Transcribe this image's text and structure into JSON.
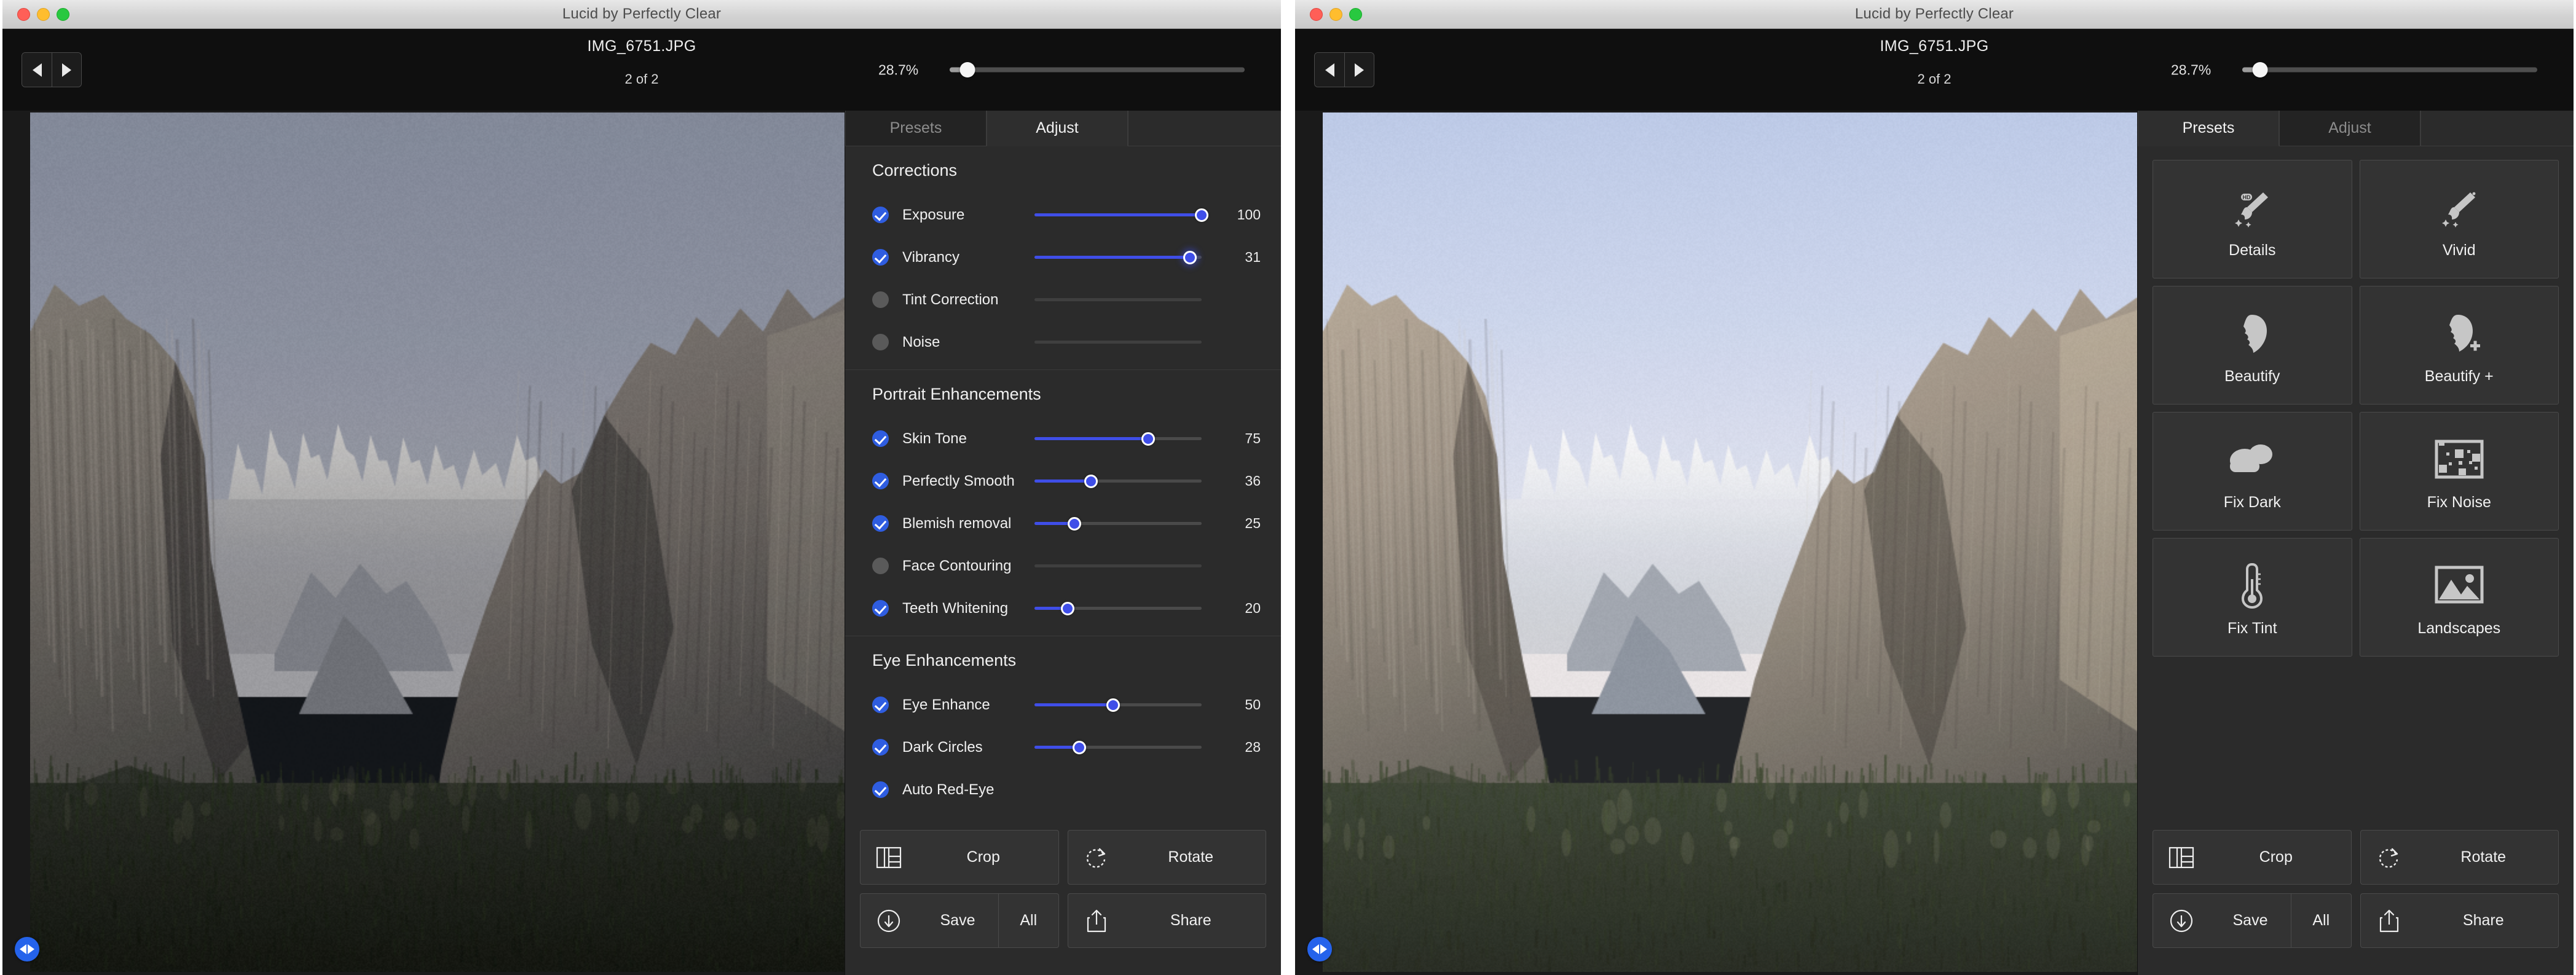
{
  "window_title": "Lucid by Perfectly Clear",
  "toolbar": {
    "prev_icon": "triangle-left-icon",
    "next_icon": "triangle-right-icon",
    "file_name": "IMG_6751.JPG",
    "file_count": "2 of 2",
    "zoom_value": "28.7%",
    "zoom_percent": 6
  },
  "tabs": {
    "presets": "Presets",
    "adjust": "Adjust"
  },
  "left_window": {
    "active_tab": "Adjust",
    "sections": [
      {
        "title": "Corrections",
        "rows": [
          {
            "label": "Exposure",
            "enabled": true,
            "value": "100",
            "percent": 100
          },
          {
            "label": "Vibrancy",
            "enabled": true,
            "value": "31",
            "percent": 93,
            "glow": true
          },
          {
            "label": "Tint Correction",
            "enabled": false,
            "value": "",
            "percent": 0
          },
          {
            "label": "Noise",
            "enabled": false,
            "value": "",
            "percent": 0
          }
        ]
      },
      {
        "title": "Portrait Enhancements",
        "rows": [
          {
            "label": "Skin Tone",
            "enabled": true,
            "value": "75",
            "percent": 68
          },
          {
            "label": "Perfectly Smooth",
            "enabled": true,
            "value": "36",
            "percent": 34
          },
          {
            "label": "Blemish removal",
            "enabled": true,
            "value": "25",
            "percent": 24
          },
          {
            "label": "Face Contouring",
            "enabled": false,
            "value": "",
            "percent": 0
          },
          {
            "label": "Teeth Whitening",
            "enabled": true,
            "value": "20",
            "percent": 20
          }
        ]
      },
      {
        "title": "Eye Enhancements",
        "rows": [
          {
            "label": "Eye Enhance",
            "enabled": true,
            "value": "50",
            "percent": 47
          },
          {
            "label": "Dark Circles",
            "enabled": true,
            "value": "28",
            "percent": 27
          },
          {
            "label": "Auto Red-Eye",
            "enabled": true,
            "value": "",
            "percent": -1
          }
        ]
      }
    ]
  },
  "right_window": {
    "active_tab": "Presets",
    "presets": [
      {
        "label": "Details",
        "icon": "brush-hd-icon"
      },
      {
        "label": "Vivid",
        "icon": "brush-icon"
      },
      {
        "label": "Beautify",
        "icon": "face-silhouette-icon"
      },
      {
        "label": "Beautify +",
        "icon": "face-silhouette-plus-icon"
      },
      {
        "label": "Fix Dark",
        "icon": "clouds-icon"
      },
      {
        "label": "Fix Noise",
        "icon": "noisy-image-icon"
      },
      {
        "label": "Fix Tint",
        "icon": "thermometer-icon"
      },
      {
        "label": "Landscapes",
        "icon": "landscape-photo-icon"
      }
    ]
  },
  "actions": {
    "crop": "Crop",
    "rotate": "Rotate",
    "save": "Save",
    "all": "All",
    "share": "Share",
    "crop_icon": "crop-grid-icon",
    "rotate_icon": "rotate-arrow-icon",
    "save_icon": "download-circle-icon",
    "share_icon": "share-box-icon"
  },
  "compare_button": {
    "icon": "compare-left-right-icon"
  },
  "colors": {
    "accent_blue": "#2f5de0",
    "slider_blue": "#3f4ee8",
    "panel_bg": "#2b2b2b",
    "tile_bg": "#333333",
    "toolbar_bg": "#0f0f0f"
  },
  "photo": {
    "scene": "Yosemite Valley Tunnel View",
    "left_variant": "original-muted",
    "right_variant": "enhanced-bright"
  }
}
